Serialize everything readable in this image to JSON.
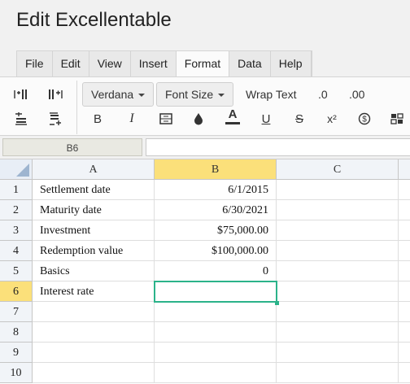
{
  "app": {
    "title": "Edit Excellentable"
  },
  "menu": [
    "File",
    "Edit",
    "View",
    "Insert",
    "Format",
    "Data",
    "Help"
  ],
  "toolbar": {
    "font_family": "Verdana",
    "font_size": "Font Size",
    "wrap_text": "Wrap Text",
    "decimal_less": ".0",
    "decimal_more": ".00",
    "bold": "B",
    "italic": "I",
    "font_color": "A",
    "underline": "U",
    "strikethrough": "S",
    "superscript": "x²",
    "accent_color": "#2bb38a"
  },
  "formula_bar": {
    "cell_ref": "B6",
    "value": ""
  },
  "sheet": {
    "columns": [
      "A",
      "B",
      "C"
    ],
    "selected_cell": "B6",
    "rows": [
      {
        "num": "1",
        "a": "Settlement date",
        "b": "6/1/2015",
        "c": ""
      },
      {
        "num": "2",
        "a": "Maturity date",
        "b": "6/30/2021",
        "c": ""
      },
      {
        "num": "3",
        "a": "Investment",
        "b": "$75,000.00",
        "c": ""
      },
      {
        "num": "4",
        "a": "Redemption value",
        "b": "$100,000.00",
        "c": ""
      },
      {
        "num": "5",
        "a": "Basics",
        "b": "0",
        "c": ""
      },
      {
        "num": "6",
        "a": "Interest rate",
        "b": "",
        "c": ""
      },
      {
        "num": "7",
        "a": "",
        "b": "",
        "c": ""
      },
      {
        "num": "8",
        "a": "",
        "b": "",
        "c": ""
      },
      {
        "num": "9",
        "a": "",
        "b": "",
        "c": ""
      },
      {
        "num": "10",
        "a": "",
        "b": "",
        "c": ""
      }
    ]
  }
}
